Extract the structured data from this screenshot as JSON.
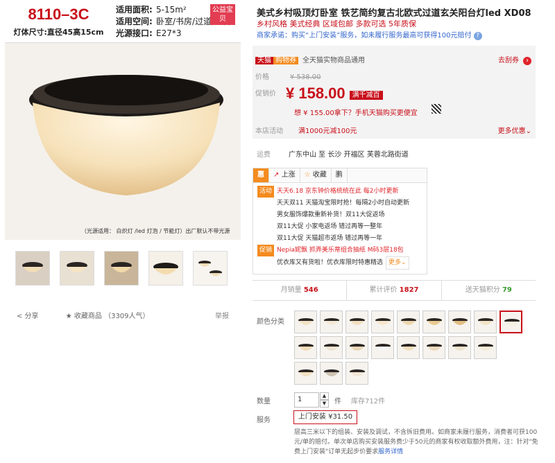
{
  "left": {
    "model": "8110–3C",
    "size": "灯体尺寸:直径45高15cm",
    "specs": [
      {
        "k": "适用面积:",
        "v": "5-15m²"
      },
      {
        "k": "适用空间:",
        "v": "卧室/书房/过道/阳台"
      },
      {
        "k": "光源接口:",
        "v": "E27*3"
      }
    ],
    "badge": "公益宝贝",
    "caption": "（光源适用： 白炽灯 /led 灯泡 / 节能灯）出厂默认不带光源",
    "share": "分享",
    "favorite": "收藏商品 （3309人气）",
    "report": "举报"
  },
  "right": {
    "title": "美式乡村吸顶灯卧室 铁艺简约复古北欧式过道玄关阳台灯led XD08",
    "subtitle": "乡村风格 美式经典 区域包邮 多款可选 5年质保",
    "promise": "商家承诺：购买“上门安装”服务，如未履行服务最高可获得100元赔付",
    "promise_icon": "?",
    "tmall": "天猫",
    "coupon_tag": "购物券",
    "coupon_note": "全天猫实物商品通用",
    "coupon_link": "去刮券",
    "price_label": "价格",
    "old_price": "¥ 538.00",
    "promo_label": "促销价",
    "promo_price": "¥ 158.00",
    "promo_tag": "满千减百",
    "mobile_offer": "想 ¥ 155.00拿下？手机天猫购买更便宜",
    "activity_label": "本店活动",
    "activity": "满1000元减100元",
    "more_promo": "更多优惠",
    "ship_label": "运费",
    "ship_value": "广东中山  至 长沙 开福区 芙蓉北路街道",
    "tabs": [
      "惠",
      "上涨",
      "收藏",
      "鹏"
    ],
    "promos": [
      {
        "label": "活动",
        "text": "天天6.18 京东钟价格统统在此 每2小时更新",
        "red": true
      },
      {
        "label": "",
        "text": "天天双11 天猫淘宝限时抢！每隔2小时自动更新",
        "red": false
      },
      {
        "label": "",
        "text": "男女服饰爆款重新补货！双11大促返场",
        "red": false
      },
      {
        "label": "",
        "text": "双11大促 小家电返场 错过再等一整年",
        "red": false
      },
      {
        "label": "",
        "text": "双11大促 天猫超市返场 错过再等一年",
        "red": false
      },
      {
        "label": "促销",
        "text": "Nepia妮飘 抓弄美乐蒂组合抽纸 M码3层18包",
        "red": true
      },
      {
        "label": "",
        "text": "优衣库又有货啦！优衣库限时特惠精选",
        "red": false
      }
    ],
    "more_btn": "更多",
    "stats": [
      {
        "label": "月销量",
        "value": "546"
      },
      {
        "label": "累计评价",
        "value": "1827"
      },
      {
        "label": "送天猫积分",
        "value": "79"
      }
    ],
    "color_label": "颜色分类",
    "qty_label": "数量",
    "qty": "1",
    "qty_unit": "件",
    "stock": "库存712件",
    "svc_label": "服务",
    "svc_btn": "上门安装 ¥31.50",
    "svc_desc": "层高三米以下的组装、安装及调试，不含拆旧费用。如商家未履行服务，消费者可获100元/单的赔付。单次单店购买安装服务费少于50元的商家有权收取额外费用，注：针对\"免费上门安装\"订单无起步价要求",
    "svc_link": "服务详情"
  },
  "colors": {
    "accent": "#c8101a",
    "orange": "#f48b1f",
    "link": "#3366cc"
  }
}
